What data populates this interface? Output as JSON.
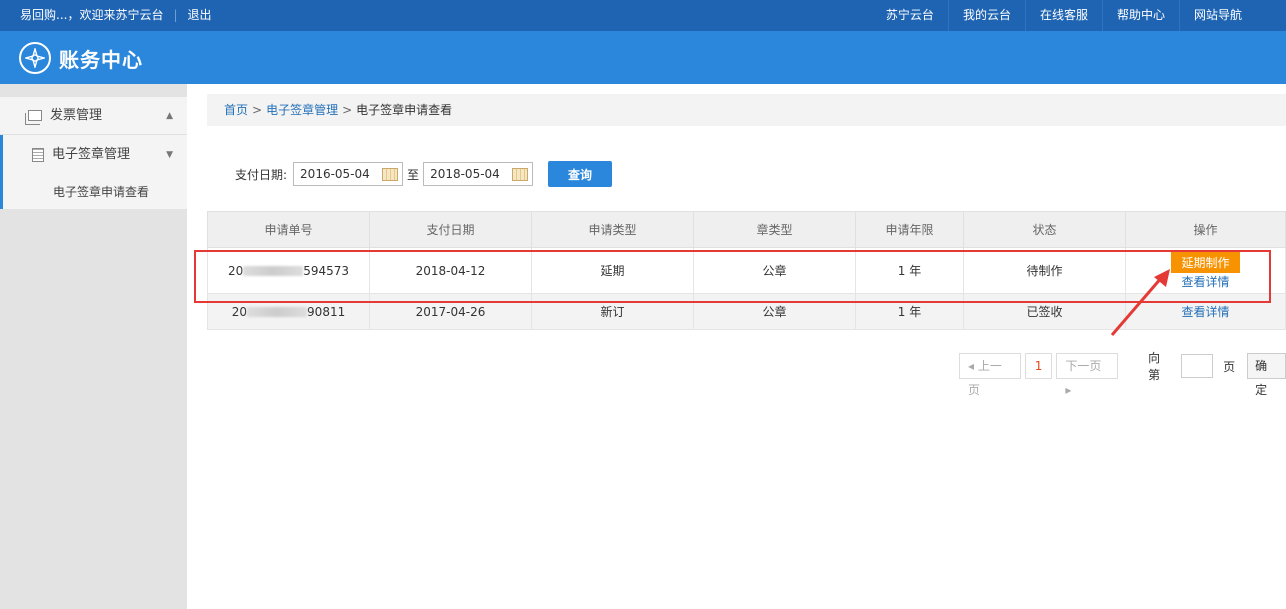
{
  "topbar": {
    "welcome": "易回购...，欢迎来苏宁云台",
    "logout": "退出",
    "links": [
      "苏宁云台",
      "我的云台",
      "在线客服",
      "帮助中心",
      "网站导航"
    ]
  },
  "header": {
    "title": "账务中心"
  },
  "sidebar": {
    "group1": "发票管理",
    "group2": "电子签章管理",
    "sub1": "电子签章申请查看"
  },
  "breadcrumb": {
    "home": "首页",
    "level1": "电子签章管理",
    "current": "电子签章申请查看"
  },
  "filter": {
    "label": "支付日期:",
    "start": "2016-05-04",
    "to": "至",
    "end": "2018-05-04",
    "query": "查询"
  },
  "table": {
    "headers": [
      "申请单号",
      "支付日期",
      "申请类型",
      "章类型",
      "申请年限",
      "状态",
      "操作"
    ],
    "rows": [
      {
        "id_prefix": "20",
        "id_suffix": "594573",
        "date": "2018-04-12",
        "type": "延期",
        "seal": "公章",
        "years": "1 年",
        "status": "待制作",
        "action1": "延期制作",
        "action2": "查看详情"
      },
      {
        "id_prefix": "20",
        "id_suffix": "90811",
        "date": "2017-04-26",
        "type": "新订",
        "seal": "公章",
        "years": "1 年",
        "status": "已签收",
        "action2": "查看详情"
      }
    ]
  },
  "pager": {
    "prev": "上一页",
    "page": "1",
    "next": "下一页",
    "goto": "向第",
    "page_unit": "页",
    "confirm": "确定"
  }
}
